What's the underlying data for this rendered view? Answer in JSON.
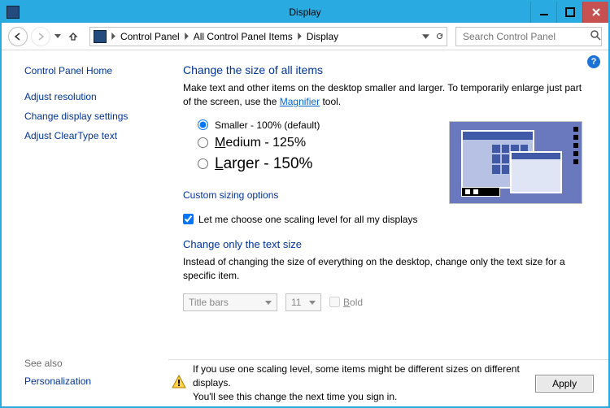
{
  "window": {
    "title": "Display"
  },
  "breadcrumb": {
    "items": [
      "Control Panel",
      "All Control Panel Items",
      "Display"
    ]
  },
  "search": {
    "placeholder": "Search Control Panel"
  },
  "sidebar": {
    "home": "Control Panel Home",
    "links": [
      "Adjust resolution",
      "Change display settings",
      "Adjust ClearType text"
    ],
    "seealso_label": "See also",
    "seealso_links": [
      "Personalization"
    ]
  },
  "main": {
    "heading1": "Change the size of all items",
    "desc_prefix": "Make text and other items on the desktop smaller and larger. To temporarily enlarge just part of the screen, use the ",
    "magnifier_link": "Magnifier",
    "desc_suffix": " tool.",
    "radios": {
      "smaller": "Smaller - 100% (default)",
      "medium": "edium - 125%",
      "medium_u": "M",
      "larger": "arger - 150%",
      "larger_u": "L"
    },
    "custom_link": "Custom sizing options",
    "checkbox_label": "Let me choose one scaling level for all my displays",
    "heading2": "Change only the text size",
    "desc2": "Instead of changing the size of everything on the desktop, change only the text size for a specific item.",
    "select_item": "Title bars",
    "select_size": "11",
    "bold_label_u": "B",
    "bold_label": "old"
  },
  "footer": {
    "line1": "If you use one scaling level, some items might be different sizes on different displays.",
    "line2": "You'll see this change the next time you sign in.",
    "apply": "Apply"
  }
}
